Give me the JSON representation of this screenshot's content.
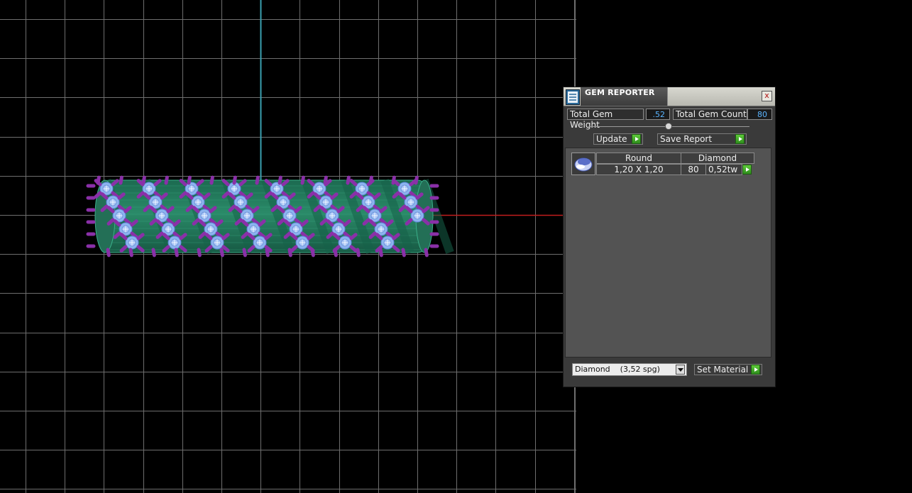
{
  "panel": {
    "title": "GEM REPORTER",
    "close_glyph": "x",
    "total_weight_label": "Total Gem Weight",
    "total_weight_value": ".52",
    "total_count_label": "Total Gem Count",
    "total_count_value": "80",
    "update_label": "Update",
    "save_report_label": "Save Report",
    "set_material_label": "Set Material",
    "material_selected": "Diamond    (3,52 spg)"
  },
  "gem_list": {
    "headers": [
      "Round",
      "Diamond"
    ],
    "rows": [
      {
        "shape": "Round",
        "size": "1,20 X 1,20",
        "material": "Diamond",
        "count": "80",
        "weight": "0,52tw"
      }
    ]
  },
  "viewport": {
    "background": "#000000",
    "grid_color": "#6e6e6e",
    "y_axis_color": "#3a9fb0",
    "x_axis_color": "#c21d1d",
    "model_color": "#2a8a68",
    "gem_color": "#8cb4ee",
    "prong_color": "#8a30a8"
  },
  "icons": {
    "app": "gem-reporter-icon",
    "close": "close-icon",
    "play": "play-arrow-icon",
    "dropdown": "chevron-down-icon",
    "gem_thumb": "round-diamond-icon"
  }
}
